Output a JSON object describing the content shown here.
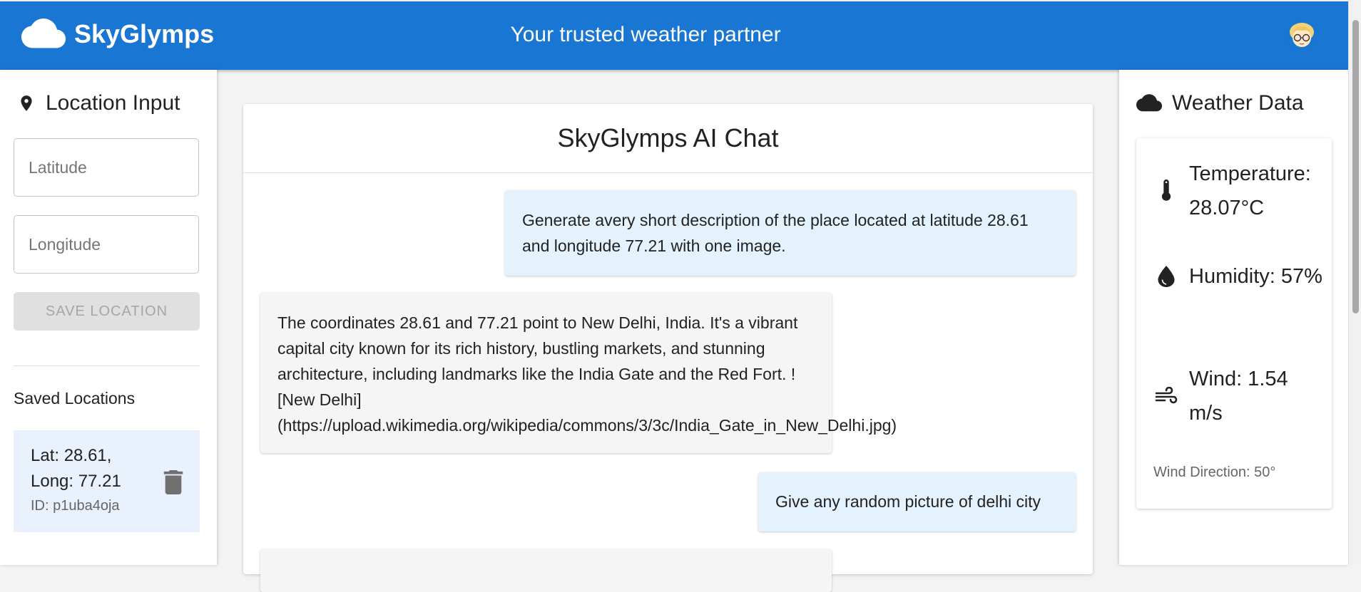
{
  "header": {
    "app_name": "SkyGlymps",
    "tagline": "Your trusted weather partner"
  },
  "location_panel": {
    "title": "Location Input",
    "latitude_placeholder": "Latitude",
    "longitude_placeholder": "Longitude",
    "save_button_label": "SAVE LOCATION",
    "saved_title": "Saved Locations",
    "saved_locations": [
      {
        "lat": "Lat: 28.61,",
        "long": "Long: 77.21",
        "id": "ID: p1uba4oja"
      }
    ]
  },
  "chat": {
    "title": "SkyGlymps AI Chat",
    "messages": [
      {
        "role": "user",
        "text": "Generate avery short description of the place located at latitude 28.61 and longitude 77.21 with one image."
      },
      {
        "role": "assistant",
        "text": "The coordinates 28.61 and 77.21 point to New Delhi, India. It's a vibrant capital city known for its rich history, bustling markets, and stunning architecture, including landmarks like the India Gate and the Red Fort. ![New Delhi]",
        "link_text": "(https://upload.wikimedia.org/wikipedia/commons/3/3c/India_Gate_in_New_Delhi.jpg)"
      },
      {
        "role": "user",
        "text": "Give any random picture of delhi city"
      }
    ]
  },
  "weather_panel": {
    "title": "Weather Data",
    "temperature": "Temperature: 28.07°C",
    "humidity": "Humidity: 57%",
    "wind": "Wind: 1.54 m/s",
    "wind_direction": "Wind Direction: 50°"
  },
  "colors": {
    "primary": "#1976d2",
    "user_bubble": "#e3f2fd",
    "bot_bubble": "#f5f5f5",
    "saved_item_bg": "#e8f1fc"
  },
  "icons": {
    "logo": "cloud-icon",
    "location": "location-pin-icon",
    "delete": "trash-icon",
    "weather": "cloud-icon",
    "temperature": "thermometer-icon",
    "humidity": "water-drop-icon",
    "wind": "wind-icon"
  }
}
